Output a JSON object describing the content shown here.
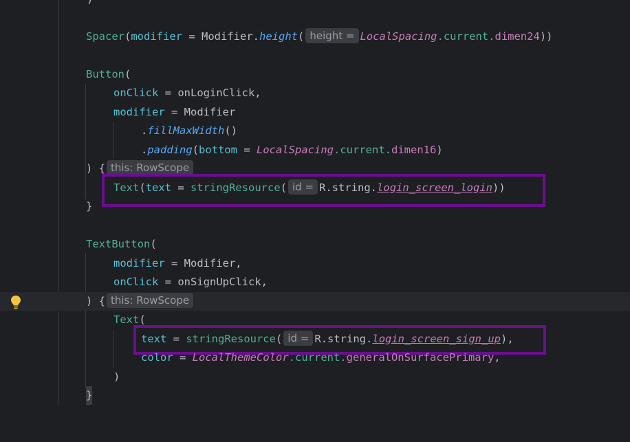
{
  "editor": {
    "lines": [
      {
        "id": "l0",
        "text": ")"
      },
      {
        "id": "l1",
        "spacer": "Spacer",
        "open": "(",
        "modifier": "modifier",
        "eq": " = ",
        "Modifier": "Modifier",
        "dot": ".",
        "height": "height",
        "paren": "(",
        "hint": "height =",
        "local": "LocalSpacing",
        "current": ".current.",
        "dimen": "dimen24",
        "close": "))"
      },
      {
        "id": "l2",
        "button": "Button",
        "open": "("
      },
      {
        "id": "l3",
        "param": "onClick",
        "eq": " = ",
        "value": "onLoginClick,"
      },
      {
        "id": "l4",
        "param": "modifier",
        "eq": " = ",
        "value": "Modifier"
      },
      {
        "id": "l5",
        "dot": ".",
        "fn": "fillMaxWidth",
        "args": "()"
      },
      {
        "id": "l6",
        "dot": ".",
        "fn": "padding",
        "open": "(",
        "param": "bottom",
        "eq": " = ",
        "local": "LocalSpacing",
        "current": ".current.",
        "dimen": "dimen16",
        "close": ")"
      },
      {
        "id": "l7",
        "brace": ") {",
        "hint": "this: RowScope"
      },
      {
        "id": "l8",
        "comp": "Text",
        "open": "(",
        "param": "text",
        "eq": " = ",
        "fn": "stringResource",
        "paren": "(",
        "hint": "id =",
        "rstring": "R.string.",
        "res": "login_screen_login",
        "close": "))"
      },
      {
        "id": "l9",
        "text": "}"
      },
      {
        "id": "l10",
        "comp": "TextButton",
        "open": "("
      },
      {
        "id": "l11",
        "param": "modifier",
        "eq": " = ",
        "value": "Modifier,"
      },
      {
        "id": "l12",
        "param": "onClick",
        "eq": " = ",
        "value": "onSignUpClick,"
      },
      {
        "id": "l13",
        "brace": ") {",
        "hint": "this: RowScope"
      },
      {
        "id": "l14",
        "comp": "Text",
        "open": "("
      },
      {
        "id": "l15",
        "param": "text",
        "eq": " = ",
        "fn": "stringResource",
        "paren": "(",
        "hint": "id =",
        "rstring": "R.string.",
        "res": "login_screen_sign_up",
        "close": "),"
      },
      {
        "id": "l16",
        "param": "color",
        "eq": " = ",
        "local": "LocalThemeColor",
        "current": ".current.",
        "prop": "generalOnSurfacePrimary",
        "comma": ","
      },
      {
        "id": "l17",
        "text": ")"
      },
      {
        "id": "l18",
        "text": "}"
      }
    ]
  },
  "colors": {
    "background": "#1e1f22",
    "highlight_border": "#6a0f8e",
    "bulb": "#f5c542"
  },
  "icons": {
    "bulb": "lightbulb-icon"
  }
}
